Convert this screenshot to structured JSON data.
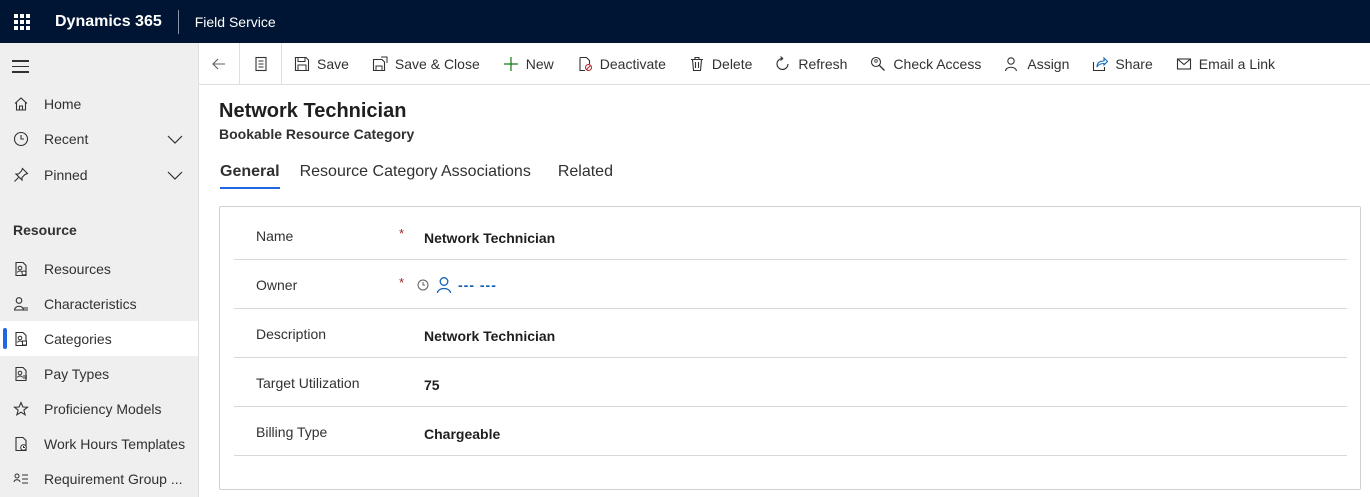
{
  "topbar": {
    "brand": "Dynamics 365",
    "app": "Field Service"
  },
  "sidebar": {
    "top_items": [
      {
        "label": "Home",
        "icon": "home-icon"
      },
      {
        "label": "Recent",
        "icon": "clock-icon",
        "expandable": true
      },
      {
        "label": "Pinned",
        "icon": "pin-icon",
        "expandable": true
      }
    ],
    "section": "Resource",
    "items": [
      {
        "label": "Resources",
        "icon": "resource-doc-icon"
      },
      {
        "label": "Characteristics",
        "icon": "person-characteristic-icon"
      },
      {
        "label": "Categories",
        "icon": "category-doc-icon",
        "active": true
      },
      {
        "label": "Pay Types",
        "icon": "pay-doc-icon"
      },
      {
        "label": "Proficiency Models",
        "icon": "star-icon"
      },
      {
        "label": "Work Hours Templates",
        "icon": "template-doc-icon"
      },
      {
        "label": "Requirement Group ...",
        "icon": "group-list-icon"
      }
    ]
  },
  "commandbar": {
    "commands": [
      {
        "label": "Save",
        "icon": "save-icon"
      },
      {
        "label": "Save & Close",
        "icon": "save-close-icon"
      },
      {
        "label": "New",
        "icon": "plus-icon"
      },
      {
        "label": "Deactivate",
        "icon": "deactivate-icon"
      },
      {
        "label": "Delete",
        "icon": "trash-icon"
      },
      {
        "label": "Refresh",
        "icon": "refresh-icon"
      },
      {
        "label": "Check Access",
        "icon": "check-access-icon"
      },
      {
        "label": "Assign",
        "icon": "assign-icon"
      },
      {
        "label": "Share",
        "icon": "share-icon"
      },
      {
        "label": "Email a Link",
        "icon": "email-icon"
      }
    ]
  },
  "form": {
    "title": "Network Technician",
    "entity": "Bookable Resource Category",
    "tabs": [
      "General",
      "Resource Category Associations",
      "Related"
    ],
    "active_tab": "General",
    "fields": [
      {
        "label": "Name",
        "required": "*",
        "value": "Network Technician"
      },
      {
        "label": "Owner",
        "required": "*",
        "value": "--- ---"
      },
      {
        "label": "Description",
        "required": "",
        "value": "Network Technician"
      },
      {
        "label": "Target Utilization",
        "required": "",
        "value": "75"
      },
      {
        "label": "Billing Type",
        "required": "",
        "value": "Chargeable"
      }
    ]
  },
  "colors": {
    "topbar": "#001433",
    "accent": "#2266e3",
    "link": "#1160b7",
    "required": "#a4262c"
  }
}
